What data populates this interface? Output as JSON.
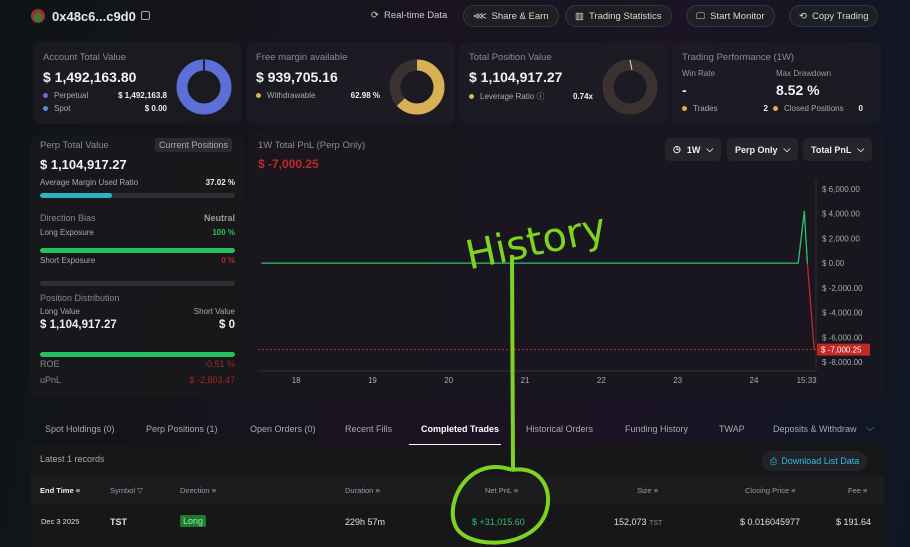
{
  "header": {
    "address": "0x48c6...c9d0",
    "buttons": [
      "Real-time Data",
      "Share & Earn",
      "Trading Statistics",
      "Start Monitor",
      "Copy Trading"
    ]
  },
  "account": {
    "title": "Account Total Value",
    "value": "$ 1,492,163.80",
    "rows": [
      {
        "label": "Perpetual",
        "value": "$ 1,492,163.8"
      },
      {
        "label": "Spot",
        "value": "$ 0.00"
      }
    ],
    "color": "#5b6fd6"
  },
  "margin": {
    "title": "Free margin available",
    "value": "$ 939,705.16",
    "row": {
      "label": "Withdrawable",
      "value": "62.98 %"
    },
    "fraction": 0.6298,
    "color": "#d9b155"
  },
  "position": {
    "title": "Total Position Value",
    "value": "$ 1,104,917.27",
    "row": {
      "label": "Leverage Ratio",
      "value": "0.74x"
    }
  },
  "performance": {
    "title": "Trading Performance (1W)",
    "win_rate_label": "Win Rate",
    "win_rate": "-",
    "drawdown_label": "Max Drawdown",
    "drawdown": "8.52 %",
    "trades_label": "Trades",
    "trades": "2",
    "closed_label": "Closed Positions",
    "closed": "0"
  },
  "perp": {
    "title": "Perp Total Value",
    "badge": "Current Positions",
    "value": "$ 1,104,917.27",
    "margin_label": "Average Margin Used Ratio",
    "margin_value": "37.02 %",
    "margin_fraction": 0.3702,
    "bias_label": "Direction Bias",
    "bias_value": "Neutral",
    "long_label": "Long Exposure",
    "long_value": "100 %",
    "long_fraction": 1,
    "short_label": "Short Exposure",
    "short_value": "0 %",
    "short_fraction": 0,
    "dist_label": "Position Distribution",
    "long_value_label": "Long Value",
    "short_value_label": "Short Value",
    "long_amount": "$ 1,104,917.27",
    "short_amount": "$ 0",
    "roe_label": "ROE",
    "roe": "-0.51 %",
    "upnl_label": "uPnL",
    "upnl": "$ -2,803.47"
  },
  "chart_data": {
    "type": "line",
    "title": "1W Total PnL (Perp Only)",
    "current": "$ -7,000.25",
    "current_value": -7000.25,
    "filters": [
      "1W",
      "Perp Only",
      "Total PnL"
    ],
    "x_ticks": [
      {
        "label": "18",
        "x": 18
      },
      {
        "label": "19",
        "x": 19
      },
      {
        "label": "20",
        "x": 20
      },
      {
        "label": "21",
        "x": 21
      },
      {
        "label": "22",
        "x": 22
      },
      {
        "label": "23",
        "x": 23
      },
      {
        "label": "24",
        "x": 24
      },
      {
        "label": "15:33",
        "x": 24.69
      }
    ],
    "y_ticks": [
      {
        "label": "$ 6,000.00",
        "v": 6000
      },
      {
        "label": "$ 4,000.00",
        "v": 4000
      },
      {
        "label": "$ 2,000.00",
        "v": 2000
      },
      {
        "label": "$ 0.00",
        "v": 0
      },
      {
        "label": "$ -2,000.00",
        "v": -2000
      },
      {
        "label": "$ -4,000.00",
        "v": -4000
      },
      {
        "label": "$ -6,000.00",
        "v": -6000
      },
      {
        "label": "$ -8,000.00",
        "v": -8000
      }
    ],
    "ylim": [
      -8000,
      6000
    ],
    "xlim": [
      17.5,
      24.8
    ],
    "points": [
      [
        17.55,
        0
      ],
      [
        24.58,
        0
      ],
      [
        24.66,
        4200
      ],
      [
        24.7,
        0
      ],
      [
        24.79,
        -7000.25
      ]
    ]
  },
  "tabs": [
    "Spot Holdings (0)",
    "Perp Positions (1)",
    "Open Orders (0)",
    "Recent Fills",
    "Completed Trades",
    "Historical Orders",
    "Funding History",
    "TWAP",
    "Deposits & Withdraw"
  ],
  "records": "Latest 1 records",
  "download": "Download List Data",
  "table": {
    "headers": [
      "End Time",
      "Symbol",
      "Direction",
      "Duration",
      "Net PnL",
      "Size",
      "Closing Price",
      "Fee"
    ],
    "rows": [
      {
        "end": "Dec 3 2025",
        "symbol": "TST",
        "direction": "Long",
        "duration": "229h 57m",
        "pnl": "$ +31,015.60",
        "size": "152,073",
        "size_unit": "TST",
        "price": "$ 0.016045977",
        "fee": "$ 191.64"
      }
    ]
  },
  "annotation": {
    "text": "History"
  }
}
